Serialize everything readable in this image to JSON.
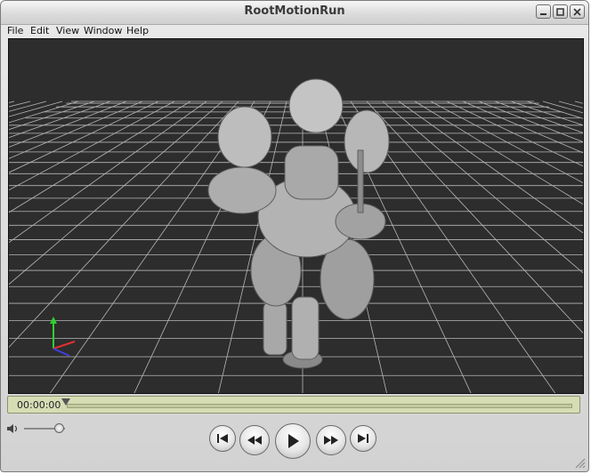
{
  "window": {
    "title": "RootMotionRun"
  },
  "menu": [
    "File",
    "Edit",
    "View",
    "Window",
    "Help"
  ],
  "player": {
    "timecode": "00:00:00",
    "progress": 0
  },
  "volume": {
    "level": 0.85
  },
  "icons": {
    "minimize": "minimize-icon",
    "maximize": "maximize-icon",
    "close": "close-icon",
    "volume": "speaker-icon",
    "go_start": "skip-to-start-icon",
    "rewind": "rewind-icon",
    "play": "play-icon",
    "fast_forward": "fast-forward-icon",
    "go_end": "skip-to-end-icon"
  },
  "colors": {
    "viewport_bg": "#2d2d2d",
    "grid": "#cfcfcf",
    "timeline_bg": "#d6ddb5",
    "axis_x": "#e03030",
    "axis_y": "#30d030",
    "axis_z": "#4040e0"
  }
}
